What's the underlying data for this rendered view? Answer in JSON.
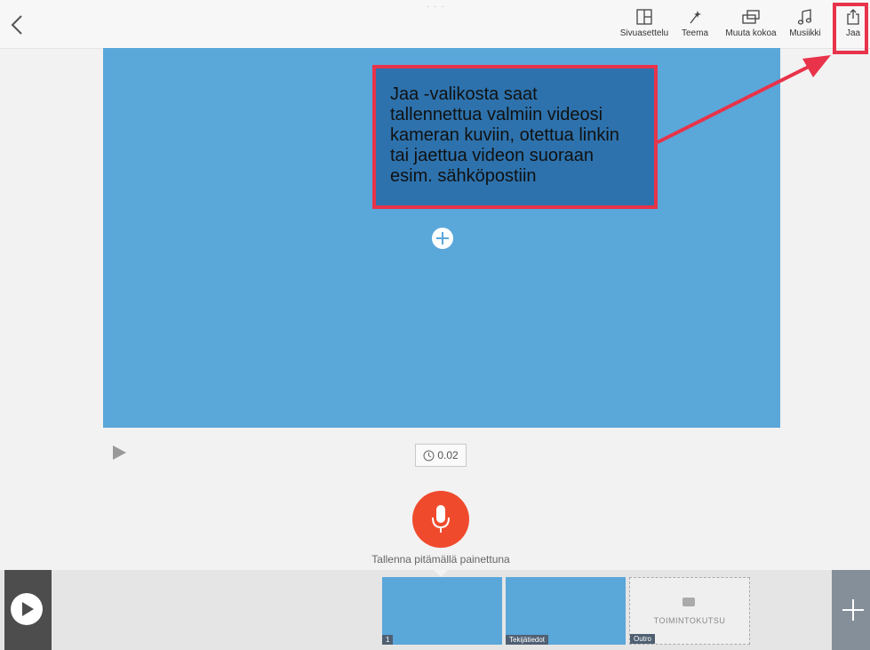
{
  "toolbar": {
    "items": [
      {
        "label": "Sivuasettelu",
        "icon": "layout-icon"
      },
      {
        "label": "Teema",
        "icon": "magic-wand-icon"
      },
      {
        "label": "Muuta kokoa",
        "icon": "resize-icon"
      },
      {
        "label": "Musiikki",
        "icon": "music-icon"
      },
      {
        "label": "Jaa",
        "icon": "share-icon"
      }
    ]
  },
  "callout": {
    "text": "Jaa -valikosta saat\ntallennettua valmiin videosi\nkameran kuviin, otettua linkin\ntai jaettua videon suoraan\nesim. sähköpostiin"
  },
  "player": {
    "duration": "0.02"
  },
  "record": {
    "hint": "Tallenna pitämällä painettuna"
  },
  "timeline": {
    "slides": [
      {
        "tag": "1"
      },
      {
        "tag": "Tekijätiedot"
      },
      {
        "tag": "Outro",
        "label": "TOIMINTOKUTSU"
      }
    ]
  },
  "colors": {
    "accent_red": "#e8334a",
    "stage_blue": "#5aa7da",
    "mic_orange": "#f04a2c"
  }
}
